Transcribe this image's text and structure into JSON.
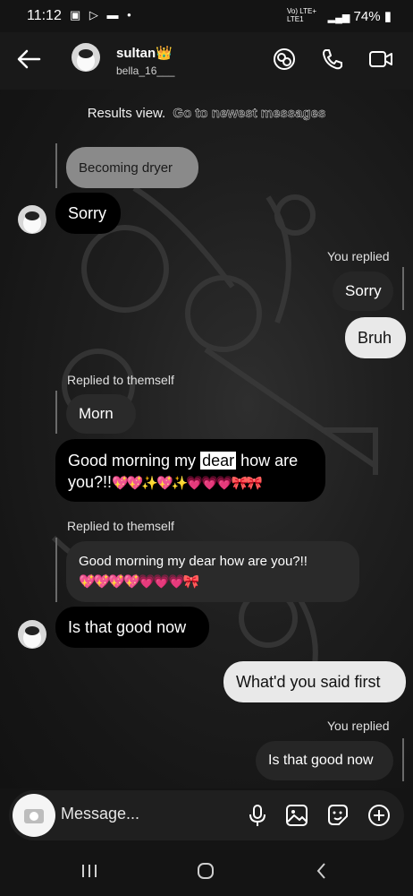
{
  "status": {
    "time": "11:12",
    "left_icons": "▣ ▷ ▬ •",
    "network": "Vo) LTE+\nLTE1",
    "battery": "74%"
  },
  "header": {
    "name": "sultan👑",
    "username": "bella_16___"
  },
  "results": {
    "text": "Results view.",
    "link": "Go to newest messages"
  },
  "messages": {
    "quote1": "Becoming dryer",
    "sorry_in": "Sorry",
    "you_replied_1": "You replied",
    "sorry_out": "Sorry",
    "bruh": "Bruh",
    "replied_themself_1": "Replied to themself",
    "morn": "Morn",
    "gm_pre": "Good morning my ",
    "gm_hl": "dear",
    "gm_post": " how are",
    "gm_line2": "you?!!",
    "gm_emojis": "💖💖✨💖✨💗💗💗🎀🎀",
    "replied_themself_2": "Replied to themself",
    "quote2_line1": "Good morning my dear how are you?!!",
    "quote2_emojis": "💖💖💖💖💗💗💗🎀",
    "is_that_good_in": "Is that good now",
    "whatd_you_said": "What'd you said first",
    "you_replied_2": "You replied",
    "is_that_good_out": "Is that good now"
  },
  "composer": {
    "placeholder": "Message..."
  },
  "colors": {
    "background": "#141414",
    "incoming": "#000000",
    "outgoing": "#262626",
    "outgoing_light": "#e9e9e9"
  }
}
